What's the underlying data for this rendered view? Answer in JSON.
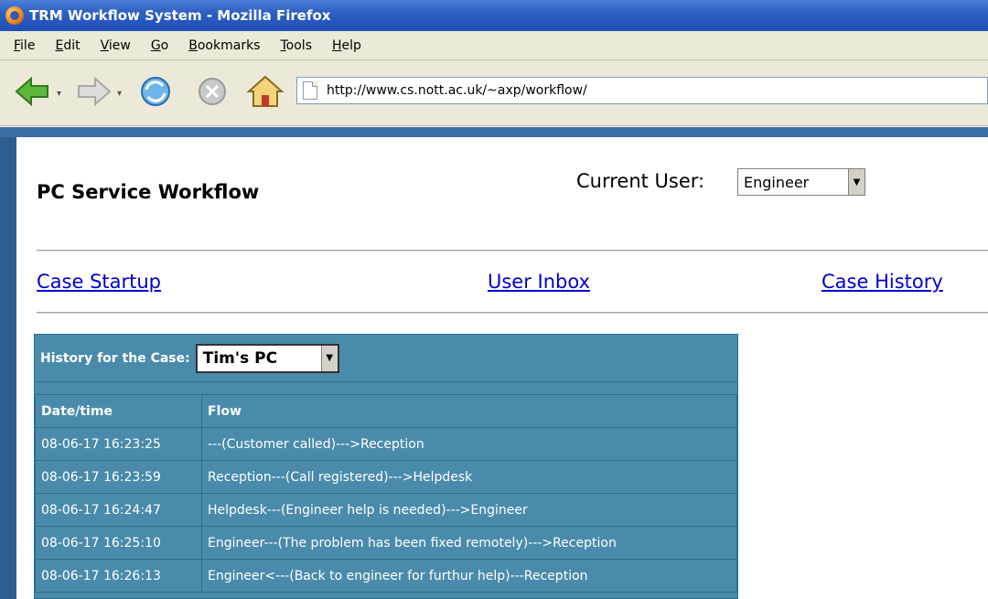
{
  "window": {
    "title": "TRM Workflow System - Mozilla Firefox"
  },
  "menu": [
    {
      "label": "File",
      "key": "F",
      "rest": "ile"
    },
    {
      "label": "Edit",
      "key": "E",
      "rest": "dit"
    },
    {
      "label": "View",
      "key": "V",
      "rest": "iew"
    },
    {
      "label": "Go",
      "key": "G",
      "rest": "o"
    },
    {
      "label": "Bookmarks",
      "key": "B",
      "rest": "ookmarks"
    },
    {
      "label": "Tools",
      "key": "T",
      "rest": "ools"
    },
    {
      "label": "Help",
      "key": "H",
      "rest": "elp"
    }
  ],
  "toolbar": {
    "address": "http://www.cs.nott.ac.uk/~axp/workflow/"
  },
  "page": {
    "title": "PC Service Workflow",
    "current_user_label": "Current User:",
    "current_user_value": "Engineer",
    "nav": {
      "startup": "Case Startup",
      "inbox": "User Inbox",
      "history": "Case History"
    }
  },
  "history": {
    "label": "History for the Case:",
    "case_value": "Tim's PC",
    "columns": [
      "Date/time",
      "Flow"
    ],
    "rows": [
      {
        "datetime": "08-06-17 16:23:25",
        "flow": "---(Customer called)--->Reception"
      },
      {
        "datetime": "08-06-17 16:23:59",
        "flow": "Reception---(Call registered)--->Helpdesk"
      },
      {
        "datetime": "08-06-17 16:24:47",
        "flow": "Helpdesk---(Engineer help is needed)--->Engineer"
      },
      {
        "datetime": "08-06-17 16:25:10",
        "flow": "Engineer---(The problem has been fixed remotely)--->Reception"
      },
      {
        "datetime": "08-06-17 16:26:13",
        "flow": "Engineer<---(Back to engineer for furthur help)---Reception"
      }
    ]
  }
}
